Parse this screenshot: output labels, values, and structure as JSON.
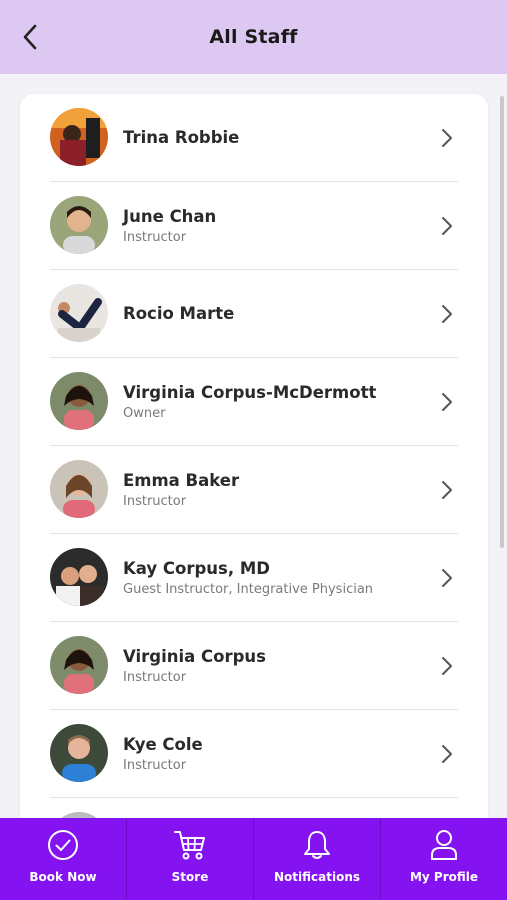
{
  "header": {
    "title": "All Staff",
    "back_icon": "chevron-left-icon"
  },
  "staff": [
    {
      "name": "Trina Robbie",
      "role": ""
    },
    {
      "name": "June Chan",
      "role": "Instructor"
    },
    {
      "name": "Rocio Marte",
      "role": ""
    },
    {
      "name": "Virginia Corpus-McDermott",
      "role": "Owner"
    },
    {
      "name": "Emma Baker",
      "role": "Instructor"
    },
    {
      "name": "Kay Corpus, MD",
      "role": "Guest Instructor, Integrative Physician"
    },
    {
      "name": "Virginia Corpus",
      "role": "Instructor"
    },
    {
      "name": "Kye Cole",
      "role": "Instructor"
    }
  ],
  "tabs": [
    {
      "label": "Book Now",
      "icon": "check-circle-icon"
    },
    {
      "label": "Store",
      "icon": "cart-icon"
    },
    {
      "label": "Notifications",
      "icon": "bell-icon"
    },
    {
      "label": "My Profile",
      "icon": "user-icon"
    }
  ],
  "colors": {
    "header_bg": "#dcc8f0",
    "tabbar_bg": "#8512f0",
    "page_bg": "#f3f2f6"
  }
}
